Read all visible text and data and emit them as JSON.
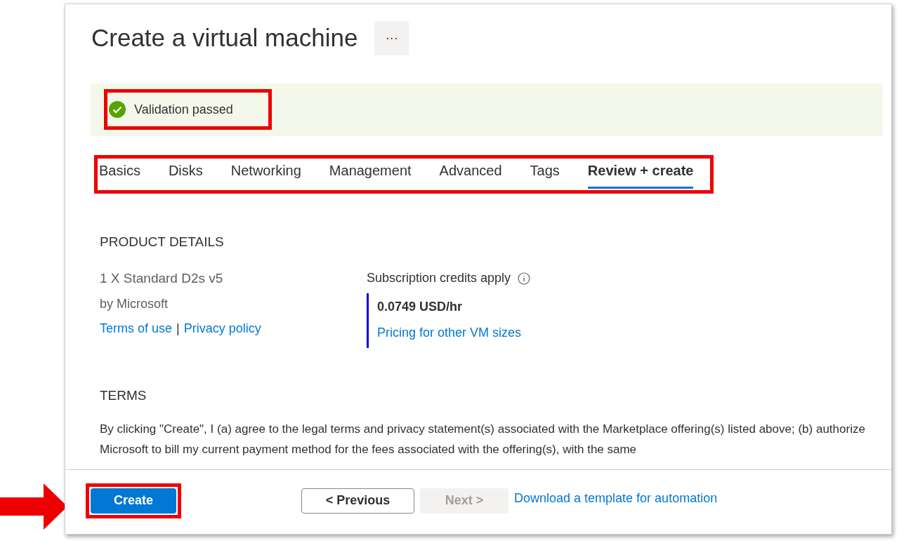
{
  "title": "Create a virtual machine",
  "more_button": "···",
  "validation": {
    "kind": "success",
    "message": "Validation passed"
  },
  "tabs": [
    {
      "label": "Basics",
      "selected": false
    },
    {
      "label": "Disks",
      "selected": false
    },
    {
      "label": "Networking",
      "selected": false
    },
    {
      "label": "Management",
      "selected": false
    },
    {
      "label": "Advanced",
      "selected": false
    },
    {
      "label": "Tags",
      "selected": false
    },
    {
      "label": "Review + create",
      "selected": true
    }
  ],
  "product_details": {
    "heading": "PRODUCT DETAILS",
    "product": "1 X Standard D2s v5",
    "publisher": "by Microsoft",
    "links": [
      "Terms of use",
      "Privacy policy"
    ],
    "separator": "|",
    "credits_label": "Subscription credits apply",
    "price": "0.0749 USD/hr",
    "pricing_link": "Pricing for other VM sizes"
  },
  "terms": {
    "heading": "TERMS",
    "text": "By clicking \"Create\", I (a) agree to the legal terms and privacy statement(s) associated with the Marketplace offering(s) listed above; (b) authorize Microsoft to bill my current payment method for the fees associated with the offering(s), with the same"
  },
  "footer": {
    "buttons": [
      {
        "label": "Create",
        "kind": "primary",
        "disabled": false
      },
      {
        "label": "< Previous",
        "kind": "secondary",
        "disabled": false
      },
      {
        "label": "Next >",
        "kind": "secondary",
        "disabled": true
      }
    ],
    "link": "Download a template for automation"
  }
}
